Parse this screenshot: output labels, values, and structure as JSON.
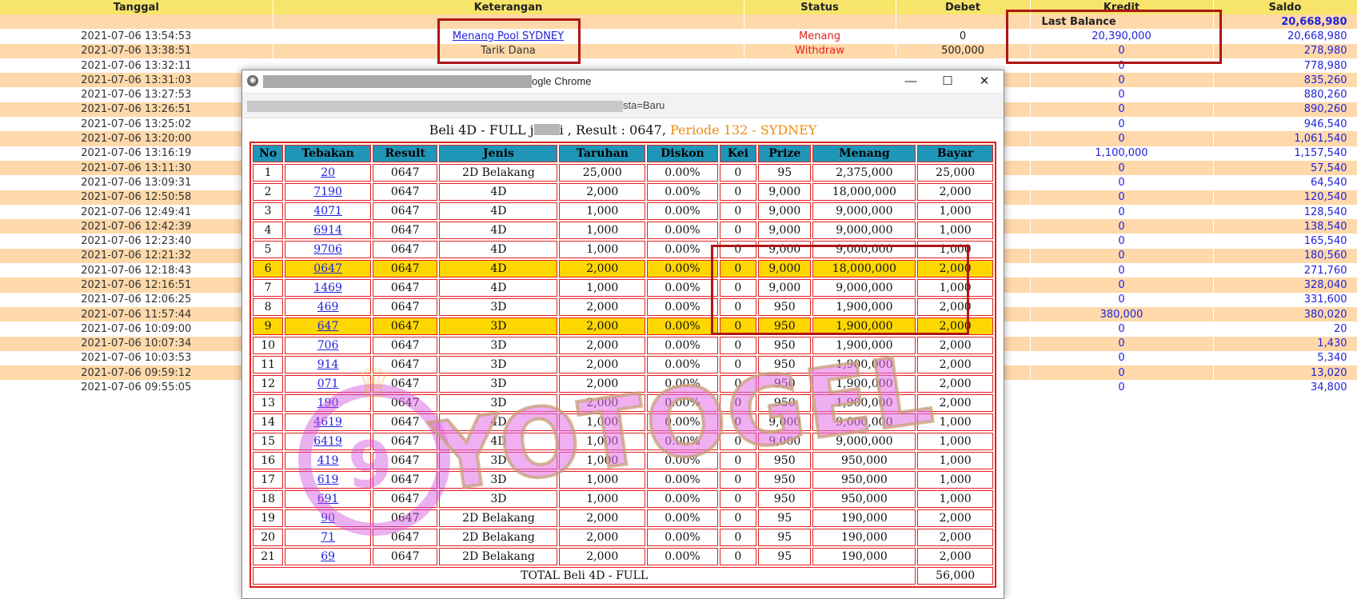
{
  "ledger": {
    "headers": [
      "Tanggal",
      "Keterangan",
      "Status",
      "Debet",
      "Kredit",
      "Saldo"
    ],
    "last_balance_label": "Last Balance",
    "last_balance_value": "20,668,980",
    "rows": [
      {
        "date": "2021-07-06 13:54:53",
        "desc": "Menang Pool SYDNEY",
        "desc_link": true,
        "status": "Menang",
        "debet": "0",
        "kredit": "20,390,000",
        "saldo": "20,668,980"
      },
      {
        "date": "2021-07-06 13:38:51",
        "desc": "Tarik Dana",
        "desc_link": false,
        "status": "Withdraw",
        "debet": "500,000",
        "kredit": "0",
        "saldo": "278,980"
      },
      {
        "date": "2021-07-06 13:32:11",
        "desc": "",
        "desc_link": false,
        "status": "",
        "debet": "",
        "kredit": "0",
        "saldo": "778,980"
      },
      {
        "date": "2021-07-06 13:31:03",
        "desc": "",
        "desc_link": false,
        "status": "",
        "debet": "",
        "kredit": "0",
        "saldo": "835,260"
      },
      {
        "date": "2021-07-06 13:27:53",
        "desc": "",
        "desc_link": false,
        "status": "",
        "debet": "",
        "kredit": "0",
        "saldo": "880,260"
      },
      {
        "date": "2021-07-06 13:26:51",
        "desc": "",
        "desc_link": false,
        "status": "",
        "debet": "",
        "kredit": "0",
        "saldo": "890,260"
      },
      {
        "date": "2021-07-06 13:25:02",
        "desc": "",
        "desc_link": false,
        "status": "",
        "debet": "",
        "kredit": "0",
        "saldo": "946,540"
      },
      {
        "date": "2021-07-06 13:20:00",
        "desc": "",
        "desc_link": false,
        "status": "",
        "debet": "",
        "kredit": "0",
        "saldo": "1,061,540"
      },
      {
        "date": "2021-07-06 13:16:19",
        "desc": "",
        "desc_link": false,
        "status": "",
        "debet": "",
        "kredit": "1,100,000",
        "saldo": "1,157,540"
      },
      {
        "date": "2021-07-06 13:11:30",
        "desc": "",
        "desc_link": false,
        "status": "",
        "debet": "",
        "kredit": "0",
        "saldo": "57,540"
      },
      {
        "date": "2021-07-06 13:09:31",
        "desc": "",
        "desc_link": false,
        "status": "",
        "debet": "",
        "kredit": "0",
        "saldo": "64,540"
      },
      {
        "date": "2021-07-06 12:50:58",
        "desc": "",
        "desc_link": false,
        "status": "",
        "debet": "",
        "kredit": "0",
        "saldo": "120,540"
      },
      {
        "date": "2021-07-06 12:49:41",
        "desc": "",
        "desc_link": false,
        "status": "",
        "debet": "",
        "kredit": "0",
        "saldo": "128,540"
      },
      {
        "date": "2021-07-06 12:42:39",
        "desc": "",
        "desc_link": false,
        "status": "",
        "debet": "",
        "kredit": "0",
        "saldo": "138,540"
      },
      {
        "date": "2021-07-06 12:23:40",
        "desc": "",
        "desc_link": false,
        "status": "",
        "debet": "",
        "kredit": "0",
        "saldo": "165,540"
      },
      {
        "date": "2021-07-06 12:21:32",
        "desc": "",
        "desc_link": false,
        "status": "",
        "debet": "",
        "kredit": "0",
        "saldo": "180,560"
      },
      {
        "date": "2021-07-06 12:18:43",
        "desc": "",
        "desc_link": false,
        "status": "",
        "debet": "",
        "kredit": "0",
        "saldo": "271,760"
      },
      {
        "date": "2021-07-06 12:16:51",
        "desc": "",
        "desc_link": false,
        "status": "",
        "debet": "",
        "kredit": "0",
        "saldo": "328,040"
      },
      {
        "date": "2021-07-06 12:06:25",
        "desc": "",
        "desc_link": false,
        "status": "",
        "debet": "",
        "kredit": "0",
        "saldo": "331,600"
      },
      {
        "date": "2021-07-06 11:57:44",
        "desc": "",
        "desc_link": false,
        "status": "",
        "debet": "",
        "kredit": "380,000",
        "saldo": "380,020"
      },
      {
        "date": "2021-07-06 10:09:00",
        "desc": "",
        "desc_link": false,
        "status": "",
        "debet": "",
        "kredit": "0",
        "saldo": "20"
      },
      {
        "date": "2021-07-06 10:07:34",
        "desc": "",
        "desc_link": false,
        "status": "",
        "debet": "",
        "kredit": "0",
        "saldo": "1,430"
      },
      {
        "date": "2021-07-06 10:03:53",
        "desc": "",
        "desc_link": false,
        "status": "",
        "debet": "",
        "kredit": "0",
        "saldo": "5,340"
      },
      {
        "date": "2021-07-06 09:59:12",
        "desc": "",
        "desc_link": false,
        "status": "",
        "debet": "",
        "kredit": "0",
        "saldo": "13,020"
      },
      {
        "date": "2021-07-06 09:55:05",
        "desc": "",
        "desc_link": false,
        "status": "",
        "debet": "",
        "kredit": "0",
        "saldo": "34,800"
      }
    ]
  },
  "popup": {
    "title_suffix": "ogle Chrome",
    "address_suffix": "sta=Baru",
    "caption_left": "Beli 4D - FULL j",
    "caption_mid": "i , Result : 0647,",
    "caption_periode": "Periode 132 - SYDNEY",
    "headers": [
      "No",
      "Tebakan",
      "Result",
      "Jenis",
      "Taruhan",
      "Diskon",
      "Kei",
      "Prize",
      "Menang",
      "Bayar"
    ],
    "rows": [
      {
        "no": "1",
        "tebakan": "20",
        "result": "0647",
        "jenis": "2D Belakang",
        "taruhan": "25,000",
        "diskon": "0.00%",
        "kei": "0",
        "prize": "95",
        "menang": "2,375,000",
        "bayar": "25,000",
        "win": false
      },
      {
        "no": "2",
        "tebakan": "7190",
        "result": "0647",
        "jenis": "4D",
        "taruhan": "2,000",
        "diskon": "0.00%",
        "kei": "0",
        "prize": "9,000",
        "menang": "18,000,000",
        "bayar": "2,000",
        "win": false
      },
      {
        "no": "3",
        "tebakan": "4071",
        "result": "0647",
        "jenis": "4D",
        "taruhan": "1,000",
        "diskon": "0.00%",
        "kei": "0",
        "prize": "9,000",
        "menang": "9,000,000",
        "bayar": "1,000",
        "win": false
      },
      {
        "no": "4",
        "tebakan": "6914",
        "result": "0647",
        "jenis": "4D",
        "taruhan": "1,000",
        "diskon": "0.00%",
        "kei": "0",
        "prize": "9,000",
        "menang": "9,000,000",
        "bayar": "1,000",
        "win": false
      },
      {
        "no": "5",
        "tebakan": "9706",
        "result": "0647",
        "jenis": "4D",
        "taruhan": "1,000",
        "diskon": "0.00%",
        "kei": "0",
        "prize": "9,000",
        "menang": "9,000,000",
        "bayar": "1,000",
        "win": false
      },
      {
        "no": "6",
        "tebakan": "0647",
        "result": "0647",
        "jenis": "4D",
        "taruhan": "2,000",
        "diskon": "0.00%",
        "kei": "0",
        "prize": "9,000",
        "menang": "18,000,000",
        "bayar": "2,000",
        "win": true
      },
      {
        "no": "7",
        "tebakan": "1469",
        "result": "0647",
        "jenis": "4D",
        "taruhan": "1,000",
        "diskon": "0.00%",
        "kei": "0",
        "prize": "9,000",
        "menang": "9,000,000",
        "bayar": "1,000",
        "win": false
      },
      {
        "no": "8",
        "tebakan": "469",
        "result": "0647",
        "jenis": "3D",
        "taruhan": "2,000",
        "diskon": "0.00%",
        "kei": "0",
        "prize": "950",
        "menang": "1,900,000",
        "bayar": "2,000",
        "win": false
      },
      {
        "no": "9",
        "tebakan": "647",
        "result": "0647",
        "jenis": "3D",
        "taruhan": "2,000",
        "diskon": "0.00%",
        "kei": "0",
        "prize": "950",
        "menang": "1,900,000",
        "bayar": "2,000",
        "win": true
      },
      {
        "no": "10",
        "tebakan": "706",
        "result": "0647",
        "jenis": "3D",
        "taruhan": "2,000",
        "diskon": "0.00%",
        "kei": "0",
        "prize": "950",
        "menang": "1,900,000",
        "bayar": "2,000",
        "win": false
      },
      {
        "no": "11",
        "tebakan": "914",
        "result": "0647",
        "jenis": "3D",
        "taruhan": "2,000",
        "diskon": "0.00%",
        "kei": "0",
        "prize": "950",
        "menang": "1,900,000",
        "bayar": "2,000",
        "win": false
      },
      {
        "no": "12",
        "tebakan": "071",
        "result": "0647",
        "jenis": "3D",
        "taruhan": "2,000",
        "diskon": "0.00%",
        "kei": "0",
        "prize": "950",
        "menang": "1,900,000",
        "bayar": "2,000",
        "win": false
      },
      {
        "no": "13",
        "tebakan": "190",
        "result": "0647",
        "jenis": "3D",
        "taruhan": "2,000",
        "diskon": "0.00%",
        "kei": "0",
        "prize": "950",
        "menang": "1,900,000",
        "bayar": "2,000",
        "win": false
      },
      {
        "no": "14",
        "tebakan": "4619",
        "result": "0647",
        "jenis": "4D",
        "taruhan": "1,000",
        "diskon": "0.00%",
        "kei": "0",
        "prize": "9,000",
        "menang": "9,000,000",
        "bayar": "1,000",
        "win": false
      },
      {
        "no": "15",
        "tebakan": "6419",
        "result": "0647",
        "jenis": "4D",
        "taruhan": "1,000",
        "diskon": "0.00%",
        "kei": "0",
        "prize": "9,000",
        "menang": "9,000,000",
        "bayar": "1,000",
        "win": false
      },
      {
        "no": "16",
        "tebakan": "419",
        "result": "0647",
        "jenis": "3D",
        "taruhan": "1,000",
        "diskon": "0.00%",
        "kei": "0",
        "prize": "950",
        "menang": "950,000",
        "bayar": "1,000",
        "win": false
      },
      {
        "no": "17",
        "tebakan": "619",
        "result": "0647",
        "jenis": "3D",
        "taruhan": "1,000",
        "diskon": "0.00%",
        "kei": "0",
        "prize": "950",
        "menang": "950,000",
        "bayar": "1,000",
        "win": false
      },
      {
        "no": "18",
        "tebakan": "691",
        "result": "0647",
        "jenis": "3D",
        "taruhan": "1,000",
        "diskon": "0.00%",
        "kei": "0",
        "prize": "950",
        "menang": "950,000",
        "bayar": "1,000",
        "win": false
      },
      {
        "no": "19",
        "tebakan": "90",
        "result": "0647",
        "jenis": "2D Belakang",
        "taruhan": "2,000",
        "diskon": "0.00%",
        "kei": "0",
        "prize": "95",
        "menang": "190,000",
        "bayar": "2,000",
        "win": false
      },
      {
        "no": "20",
        "tebakan": "71",
        "result": "0647",
        "jenis": "2D Belakang",
        "taruhan": "2,000",
        "diskon": "0.00%",
        "kei": "0",
        "prize": "95",
        "menang": "190,000",
        "bayar": "2,000",
        "win": false
      },
      {
        "no": "21",
        "tebakan": "69",
        "result": "0647",
        "jenis": "2D Belakang",
        "taruhan": "2,000",
        "diskon": "0.00%",
        "kei": "0",
        "prize": "95",
        "menang": "190,000",
        "bayar": "2,000",
        "win": false
      }
    ],
    "total_label": "TOTAL  Beli 4D - FULL",
    "total_value": "56,000"
  },
  "watermark": {
    "brand": "YOTOGEL",
    "logo_digit": "9"
  },
  "colors": {
    "header_yellow": "#f7e46a",
    "row_peach": "#ffd9aa",
    "link_blue": "#2222dd",
    "status_red": "#e02020",
    "table_header_teal": "#1f96b8",
    "win_gold": "#ffd700",
    "highlight_red": "#b01515",
    "periode_orange": "#f08a0a"
  }
}
